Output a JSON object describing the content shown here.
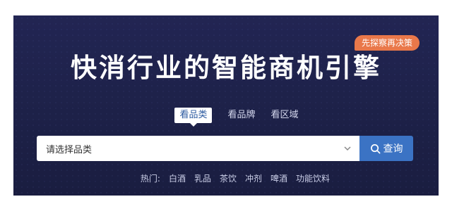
{
  "hero": {
    "title": "快消行业的智能商机引擎",
    "badge": "先探察再决策"
  },
  "tabs": [
    {
      "label": "看品类",
      "active": true
    },
    {
      "label": "看品牌",
      "active": false
    },
    {
      "label": "看区域",
      "active": false
    }
  ],
  "search": {
    "select_value": "请选择品类",
    "button_label": "查询"
  },
  "hot": {
    "label": "热门:",
    "items": [
      "白酒",
      "乳品",
      "茶饮",
      "冲剂",
      "啤酒",
      "功能饮料"
    ]
  },
  "colors": {
    "background": "#1f2249",
    "badge": "#e9784a",
    "button": "#3b73c4",
    "active_tab_text": "#2c5aa0"
  },
  "icons": {
    "search": "search-icon",
    "dropdown": "chevron-down-icon"
  }
}
